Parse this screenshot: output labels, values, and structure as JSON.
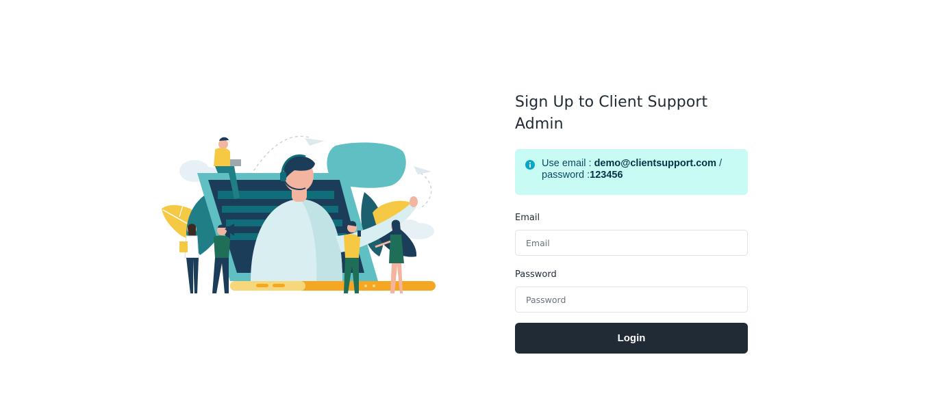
{
  "form": {
    "title": "Sign Up to Client Support Admin",
    "alert": {
      "icon": "info-icon",
      "prefix": "Use email : ",
      "email": "demo@clientsupport.com",
      "separator": " /",
      "password_prefix": "password :",
      "password": "123456"
    },
    "email_label": "Email",
    "email_placeholder": "Email",
    "email_value": "",
    "password_label": "Password",
    "password_placeholder": "Password",
    "password_value": "",
    "login_label": "Login"
  },
  "colors": {
    "primary_dark": "#212b36",
    "alert_bg": "#c7fbf4",
    "info_icon": "#06a6c9",
    "illustration_teal": "#5fbfc2",
    "illustration_navy": "#1c3d5a",
    "illustration_yellow": "#f6c945"
  },
  "illustration": {
    "subject": "customer-support-agent-illustration"
  }
}
